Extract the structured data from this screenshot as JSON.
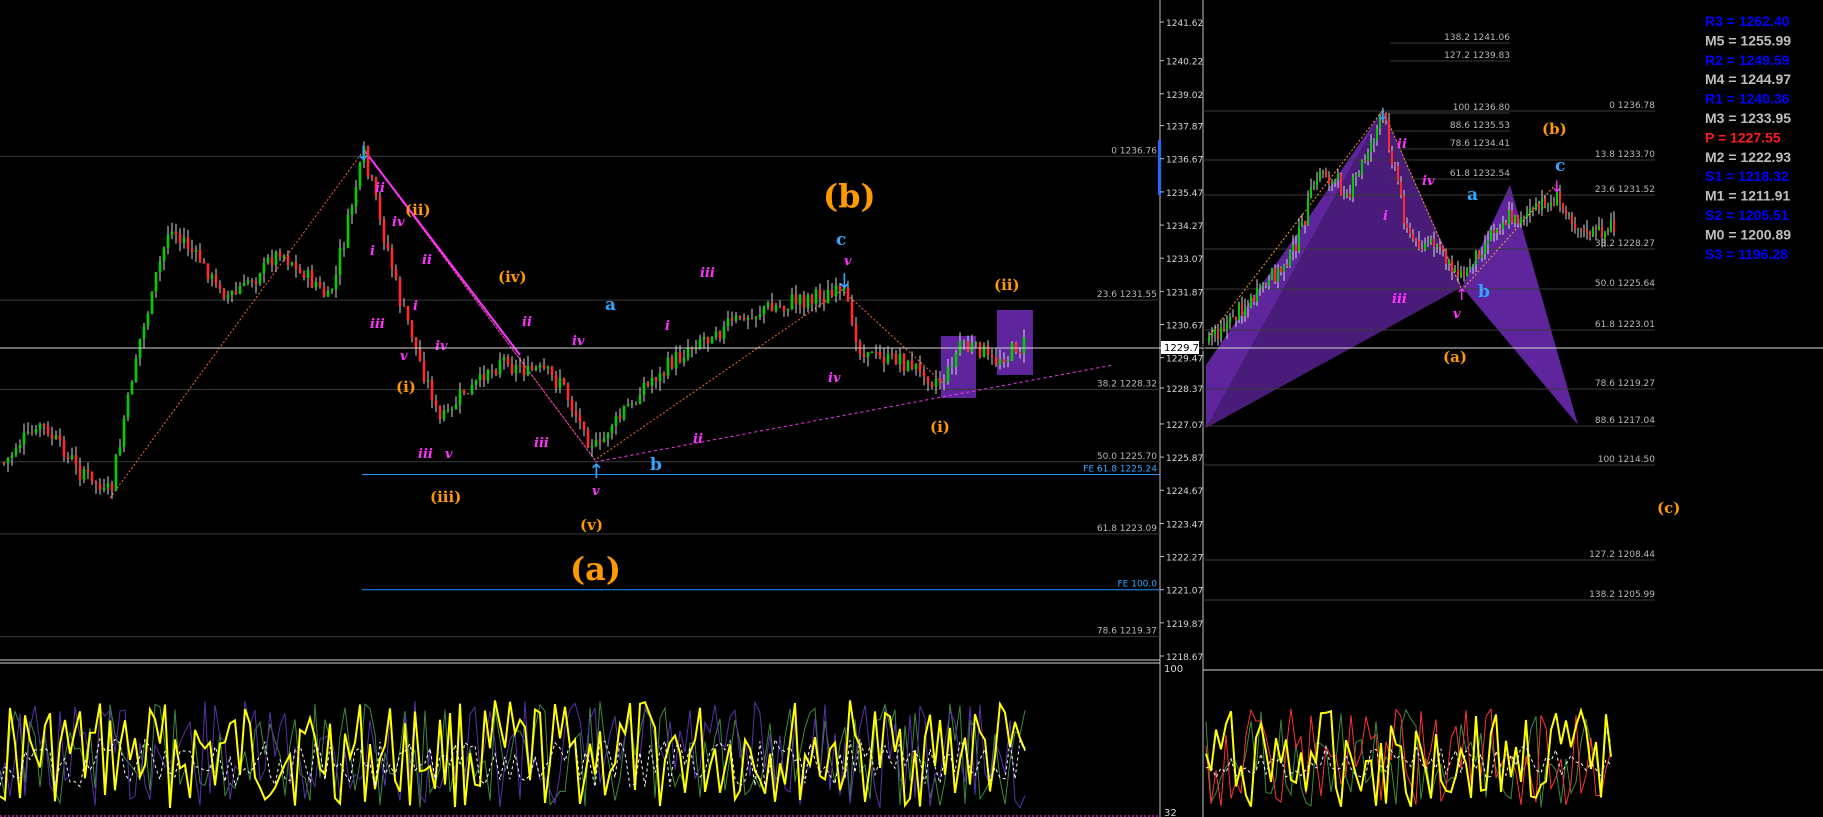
{
  "colors": {
    "bg": "#000000",
    "grid": "#3a3a3a",
    "candle_up": "#00cc00",
    "candle_down": "#ff2a2a",
    "wick": "#d6d6d6",
    "wave_magenta": "#ff33ff",
    "wave_orange": "#ff9900",
    "wave_cyan": "#33a6ff",
    "pattern_purple": "#6f2bb8",
    "osc_yellow": "#ffff00",
    "osc_white": "#ffffff",
    "fib_text": "#b8b8b8",
    "pivot_blue": "#0000ff",
    "pivot_gray": "#bfbfbf",
    "pivot_red": "#ff1a1a"
  },
  "chart_data": [
    {
      "type": "candlestick",
      "ylim": [
        1218.67,
        1241.62
      ],
      "ticks": [
        "1241.62",
        "1240.22",
        "1239.02",
        "1237.87",
        "1236.67",
        "1235.47",
        "1234.27",
        "1233.07",
        "1231.87",
        "1230.67",
        "1229.47",
        "1228.37",
        "1227.07",
        "1225.87",
        "1224.67",
        "1223.47",
        "1222.27",
        "1221.07",
        "1219.87",
        "1218.67"
      ],
      "current_price": "1229.75",
      "fib_levels_left": [
        {
          "label": "0 1236.76",
          "value": 1236.76
        },
        {
          "label": "23.6 1231.55",
          "value": 1231.55
        },
        {
          "label": "38.2 1228.32",
          "value": 1228.32
        },
        {
          "label": "50.0 1225.70",
          "value": 1225.7
        },
        {
          "label": "61.8 1223.09",
          "value": 1223.09
        },
        {
          "label": "78.6 1219.37",
          "value": 1219.37
        }
      ],
      "fe_levels": [
        {
          "label": "FE 61.8 1225.24",
          "value": 1225.24
        },
        {
          "label": "FE 100.0",
          "value": 1221.07
        }
      ],
      "wave_labels": [
        {
          "text": "(b)",
          "color": "orange"
        },
        {
          "text": "(a)",
          "color": "orange"
        },
        {
          "text": "c",
          "color": "cyan"
        },
        {
          "text": "a",
          "color": "cyan"
        },
        {
          "text": "b",
          "color": "cyan"
        },
        {
          "text": "(ii)",
          "color": "orange"
        },
        {
          "text": "(iv)",
          "color": "orange"
        },
        {
          "text": "(i)",
          "color": "orange"
        },
        {
          "text": "(iii)",
          "color": "orange"
        },
        {
          "text": "(v)",
          "color": "orange"
        },
        {
          "text": "(ii)",
          "color": "orange"
        },
        {
          "text": "(i)",
          "color": "orange"
        },
        {
          "text": "ii",
          "color": "magenta"
        },
        {
          "text": "iv",
          "color": "magenta"
        },
        {
          "text": "i",
          "color": "magenta"
        },
        {
          "text": "ii",
          "color": "magenta"
        },
        {
          "text": "iii",
          "color": "magenta"
        },
        {
          "text": "i",
          "color": "magenta"
        },
        {
          "text": "v",
          "color": "magenta"
        },
        {
          "text": "iv",
          "color": "magenta"
        },
        {
          "text": "iii",
          "color": "magenta"
        },
        {
          "text": "v",
          "color": "magenta"
        },
        {
          "text": "ii",
          "color": "magenta"
        },
        {
          "text": "iii",
          "color": "magenta"
        },
        {
          "text": "iv",
          "color": "magenta"
        },
        {
          "text": "v",
          "color": "magenta"
        },
        {
          "text": "i",
          "color": "magenta"
        },
        {
          "text": "iii",
          "color": "magenta"
        },
        {
          "text": "ii",
          "color": "magenta"
        },
        {
          "text": "iv",
          "color": "magenta"
        },
        {
          "text": "v",
          "color": "magenta"
        }
      ],
      "oscillator": {
        "ticks": [
          "100",
          "32"
        ]
      }
    },
    {
      "type": "candlestick",
      "fib_levels_right": [
        {
          "label": "138.2 1241.06"
        },
        {
          "label": "127.2 1239.83"
        },
        {
          "label": "100 1236.80"
        },
        {
          "label": "88.6 1235.53"
        },
        {
          "label": "78.6 1234.41"
        },
        {
          "label": "61.8 1232.54"
        },
        {
          "label": "0 1236.78"
        },
        {
          "label": "13.8 1233.70"
        },
        {
          "label": "23.6 1231.52"
        },
        {
          "label": "38.2 1228.27"
        },
        {
          "label": "50.0 1225.64"
        },
        {
          "label": "61.8 1223.01"
        },
        {
          "label": "78.6 1219.27"
        },
        {
          "label": "88.6 1217.04"
        },
        {
          "label": "100 1214.50"
        },
        {
          "label": "127.2 1208.44"
        },
        {
          "label": "138.2 1205.99"
        }
      ],
      "wave_labels": [
        {
          "text": "(b)",
          "color": "orange"
        },
        {
          "text": "(a)",
          "color": "orange"
        },
        {
          "text": "(c)",
          "color": "orange"
        },
        {
          "text": "c",
          "color": "cyan"
        },
        {
          "text": "a",
          "color": "cyan"
        },
        {
          "text": "b",
          "color": "cyan"
        },
        {
          "text": "ii",
          "color": "magenta"
        },
        {
          "text": "iv",
          "color": "magenta"
        },
        {
          "text": "i",
          "color": "magenta"
        },
        {
          "text": "iii",
          "color": "magenta"
        },
        {
          "text": "v",
          "color": "magenta"
        }
      ]
    }
  ],
  "pivots": [
    {
      "label": "R3 = 1262.40",
      "color": "blue"
    },
    {
      "label": "M5 = 1255.99",
      "color": "gray"
    },
    {
      "label": "R2 = 1249.59",
      "color": "blue"
    },
    {
      "label": "M4 = 1244.97",
      "color": "gray"
    },
    {
      "label": "R1 = 1240.36",
      "color": "blue"
    },
    {
      "label": "M3 = 1233.95",
      "color": "gray"
    },
    {
      "label": "P = 1227.55",
      "color": "red"
    },
    {
      "label": "M2 = 1222.93",
      "color": "gray"
    },
    {
      "label": "S1 = 1218.32",
      "color": "blue"
    },
    {
      "label": "M1 = 1211.91",
      "color": "gray"
    },
    {
      "label": "S2 = 1205.51",
      "color": "blue"
    },
    {
      "label": "M0 = 1200.89",
      "color": "gray"
    },
    {
      "label": "S3 = 1196.28",
      "color": "blue"
    }
  ]
}
